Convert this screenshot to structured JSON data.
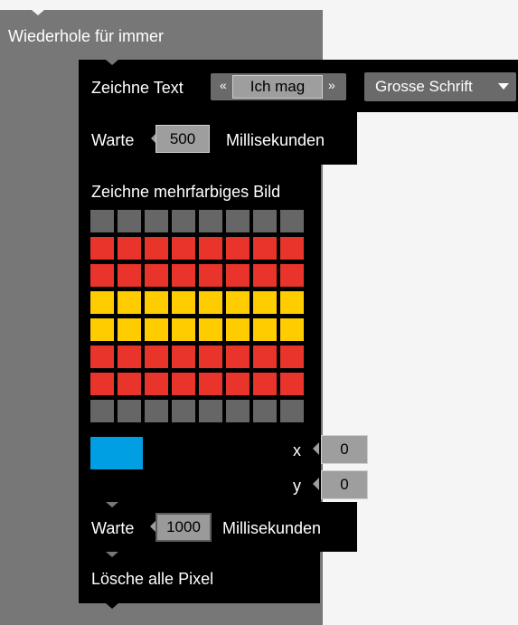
{
  "loop": {
    "label": "Wiederhole für immer"
  },
  "draw_text": {
    "label": "Zeichne Text",
    "left_chevron": "«",
    "text": "Ich mag",
    "right_chevron": "»",
    "font_dropdown": "Grosse Schrift"
  },
  "wait1": {
    "label": "Warte",
    "value": "500",
    "unit": "Millisekunden"
  },
  "draw_image": {
    "label": "Zeichne mehrfarbiges Bild",
    "grid_rows": [
      [
        "#666666",
        "#666666",
        "#666666",
        "#666666",
        "#666666",
        "#666666",
        "#666666",
        "#666666"
      ],
      [
        "#e8342a",
        "#e8342a",
        "#e8342a",
        "#e8342a",
        "#e8342a",
        "#e8342a",
        "#e8342a",
        "#e8342a"
      ],
      [
        "#e8342a",
        "#e8342a",
        "#e8342a",
        "#e8342a",
        "#e8342a",
        "#e8342a",
        "#e8342a",
        "#e8342a"
      ],
      [
        "#ffcc00",
        "#ffcc00",
        "#ffcc00",
        "#ffcc00",
        "#ffcc00",
        "#ffcc00",
        "#ffcc00",
        "#ffcc00"
      ],
      [
        "#ffcc00",
        "#ffcc00",
        "#ffcc00",
        "#ffcc00",
        "#ffcc00",
        "#ffcc00",
        "#ffcc00",
        "#ffcc00"
      ],
      [
        "#e8342a",
        "#e8342a",
        "#e8342a",
        "#e8342a",
        "#e8342a",
        "#e8342a",
        "#e8342a",
        "#e8342a"
      ],
      [
        "#e8342a",
        "#e8342a",
        "#e8342a",
        "#e8342a",
        "#e8342a",
        "#e8342a",
        "#e8342a",
        "#e8342a"
      ],
      [
        "#666666",
        "#666666",
        "#666666",
        "#666666",
        "#666666",
        "#666666",
        "#666666",
        "#666666"
      ]
    ],
    "selected_color": "#009fe3",
    "x_label": "x",
    "x_value": "0",
    "y_label": "y",
    "y_value": "0"
  },
  "wait2": {
    "label": "Warte",
    "value": "1000",
    "unit": "Millisekunden"
  },
  "clear": {
    "label": "Lösche alle Pixel"
  }
}
